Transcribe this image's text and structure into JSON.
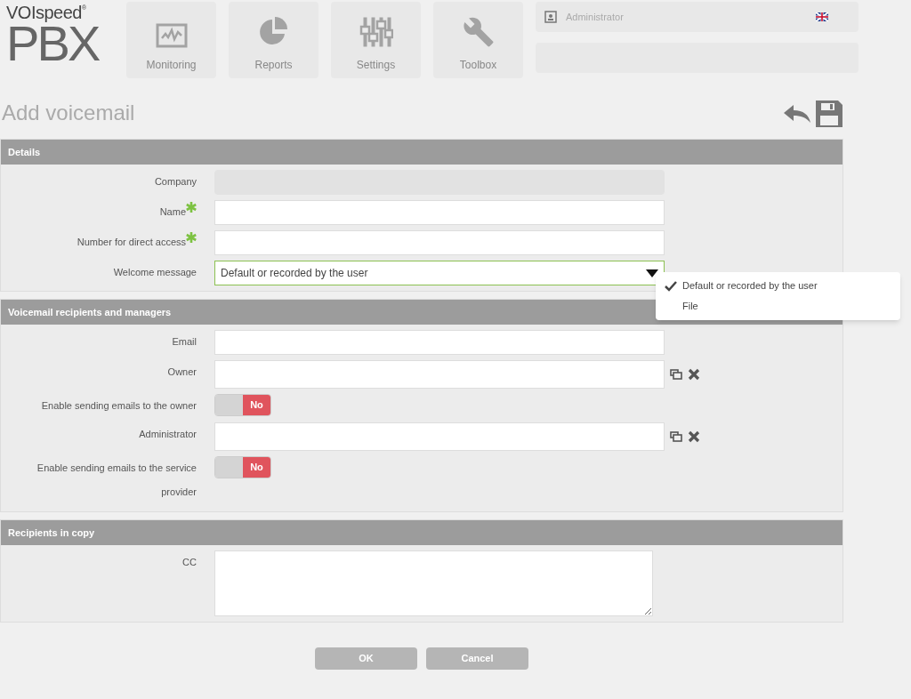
{
  "logo": {
    "brand": "VOIspeed",
    "registered": "®",
    "product": "PBX"
  },
  "nav": [
    {
      "label": "Monitoring",
      "kind": "monitor"
    },
    {
      "label": "Reports",
      "kind": "pie"
    },
    {
      "label": "Settings",
      "kind": "sliders"
    },
    {
      "label": "Toolbox",
      "kind": "wrench"
    }
  ],
  "user": {
    "name": "Administrator"
  },
  "page_title": "Add voicemail",
  "sections": [
    {
      "title": "Details",
      "fields": [
        {
          "kind": "readonly",
          "label": "Company",
          "required": false
        },
        {
          "kind": "text",
          "label": "Name",
          "required": true
        },
        {
          "kind": "text",
          "label": "Number for direct access",
          "required": true
        },
        {
          "kind": "select",
          "label": "Welcome message",
          "required": false,
          "value": "Default or recorded by the user",
          "expanded": true,
          "options": [
            {
              "label": "Default or recorded by the user",
              "selected": true
            },
            {
              "label": "File",
              "selected": false
            }
          ]
        }
      ]
    },
    {
      "title": "Voicemail recipients and managers",
      "fields": [
        {
          "kind": "text",
          "label": "Email",
          "required": false
        },
        {
          "kind": "lookup",
          "label": "Owner",
          "required": false
        },
        {
          "kind": "toggle",
          "label": "Enable sending emails to the owner",
          "on": false,
          "state_label": "No"
        },
        {
          "kind": "lookup",
          "label": "Administrator",
          "required": false
        },
        {
          "kind": "toggle",
          "label": "Enable sending emails to the service provider",
          "on": false,
          "state_label": "No"
        }
      ]
    },
    {
      "title": "Recipients in copy",
      "fields": [
        {
          "kind": "textarea",
          "label": "CC",
          "required": false
        }
      ]
    }
  ],
  "buttons": [
    "OK",
    "Cancel"
  ]
}
